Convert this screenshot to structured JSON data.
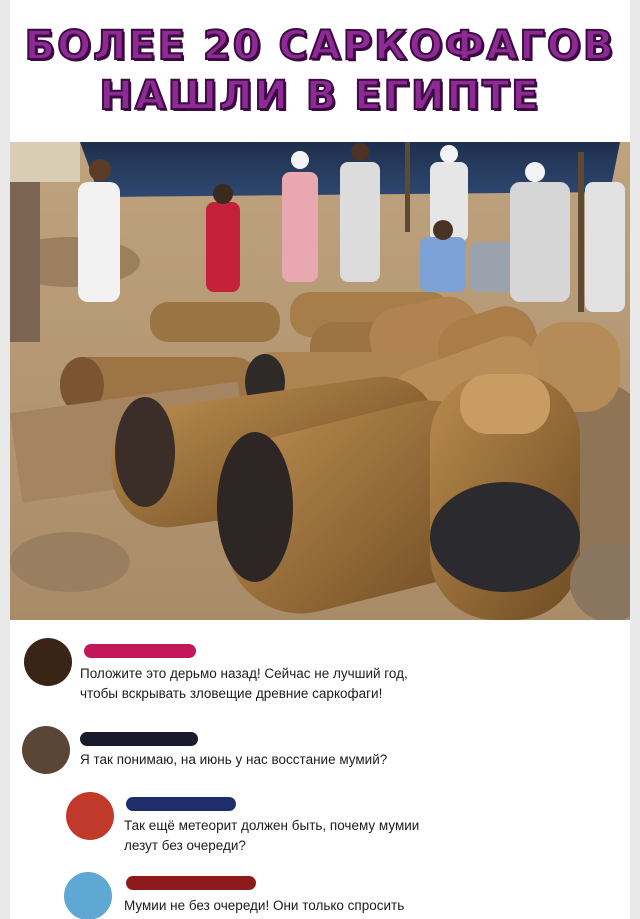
{
  "headline": {
    "line1": "БОЛЕЕ 20 САРКОФАГОВ",
    "line2": "НАШЛИ В ЕГИПТЕ",
    "color": "#8e2a94"
  },
  "photo": {
    "subject": "sarcophagi-excavation"
  },
  "comments": [
    {
      "avatar_color": "#3a2418",
      "name_redaction_color": "#c2185b",
      "lines": [
        "Положите это дерьмо назад! Сейчас не лучший год,",
        "чтобы вскрывать зловещие древние саркофаги!"
      ]
    },
    {
      "avatar_color": "#5a4636",
      "name_redaction_color": "#1a1a2e",
      "lines": [
        "Я так понимаю, на июнь у нас восстание мумий?"
      ]
    },
    {
      "avatar_color": "#c0392b",
      "name_redaction_color": "#1f2d6b",
      "lines": [
        "Так ещё метеорит должен быть, почему мумии",
        "лезут без очереди?"
      ]
    },
    {
      "avatar_color": "#5fa8d3",
      "name_redaction_color": "#8e1b1b",
      "lines": [
        "Мумии не без очереди! Они только спросить"
      ]
    }
  ]
}
